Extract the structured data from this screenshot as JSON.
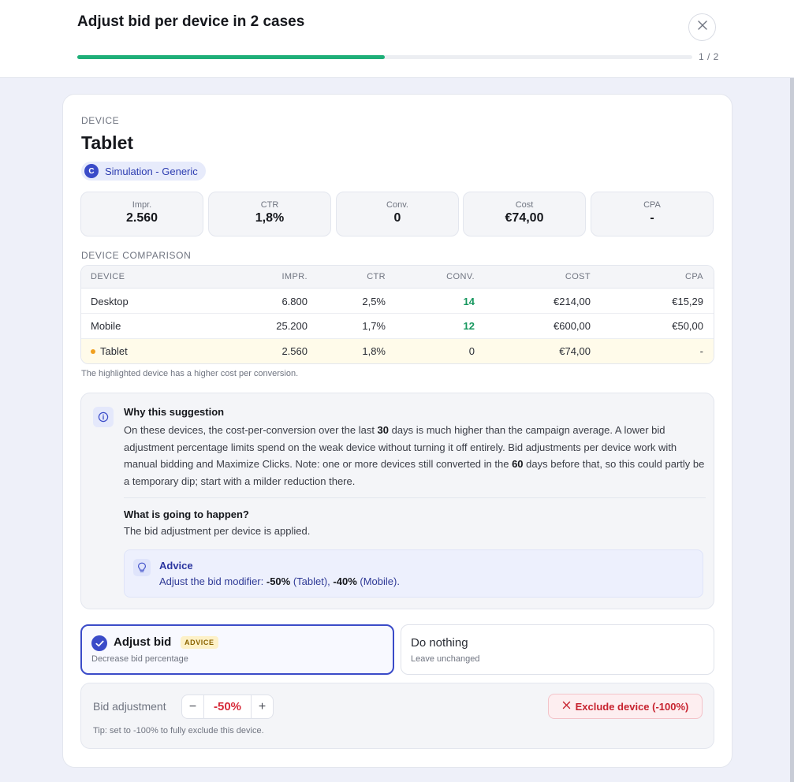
{
  "header": {
    "title": "Adjust bid per device in 2 cases",
    "progress_label": "1 / 2",
    "progress_fraction": 0.5
  },
  "device": {
    "section_label": "DEVICE",
    "name": "Tablet",
    "campaign_initial": "C",
    "campaign_name": "Simulation - Generic"
  },
  "metrics": [
    {
      "label": "Impr.",
      "value": "2.560"
    },
    {
      "label": "CTR",
      "value": "1,8%"
    },
    {
      "label": "Conv.",
      "value": "0"
    },
    {
      "label": "Cost",
      "value": "€74,00"
    },
    {
      "label": "CPA",
      "value": "-"
    }
  ],
  "comparison": {
    "section_label": "DEVICE COMPARISON",
    "columns": [
      "DEVICE",
      "IMPR.",
      "CTR",
      "CONV.",
      "COST",
      "CPA"
    ],
    "rows": [
      {
        "device": "Desktop",
        "impr": "6.800",
        "ctr": "2,5%",
        "conv": "14",
        "cost": "€214,00",
        "cpa": "€15,29"
      },
      {
        "device": "Mobile",
        "impr": "25.200",
        "ctr": "1,7%",
        "conv": "12",
        "cost": "€600,00",
        "cpa": "€50,00"
      },
      {
        "device": "Tablet",
        "impr": "2.560",
        "ctr": "1,8%",
        "conv": "0",
        "cost": "€74,00",
        "cpa": "-"
      }
    ],
    "note": "The highlighted device has a higher cost per conversion."
  },
  "why": {
    "title": "Why this suggestion",
    "body_a": "On these devices, the cost-per-conversion over the last ",
    "days_1": "30",
    "body_b": " days is much higher than the campaign average. A lower bid adjustment percentage limits spend on the weak device without turning it off entirely. Bid adjustments per device work with manual bidding and Maximize Clicks. Note: one or more devices still converted in the ",
    "days_2": "60",
    "body_c": " days before that, so this could partly be a temporary dip; start with a milder reduction there.",
    "what_title": "What is going to happen?",
    "what_body": "The bid adjustment per device is applied.",
    "advice_title": "Advice",
    "advice_a": "Adjust the bid modifier: ",
    "advice_v1": "-50%",
    "advice_b": " (Tablet), ",
    "advice_v2": "-40%",
    "advice_c": " (Mobile)."
  },
  "options": {
    "adjust_title": "Adjust bid",
    "adjust_badge": "ADVICE",
    "adjust_sub": "Decrease bid percentage",
    "nothing_title": "Do nothing",
    "nothing_sub": "Leave unchanged"
  },
  "adjustment": {
    "label": "Bid adjustment",
    "minus": "−",
    "value": "-50%",
    "plus": "+",
    "exclude_label": "Exclude device (-100%)",
    "tip": "Tip: set to -100% to fully exclude this device."
  },
  "colors": {
    "accent": "#3a4bc8",
    "progress": "#1eaf78",
    "positive": "#16975e",
    "danger": "#d62b3a",
    "highlight_row": "#fffbea"
  }
}
